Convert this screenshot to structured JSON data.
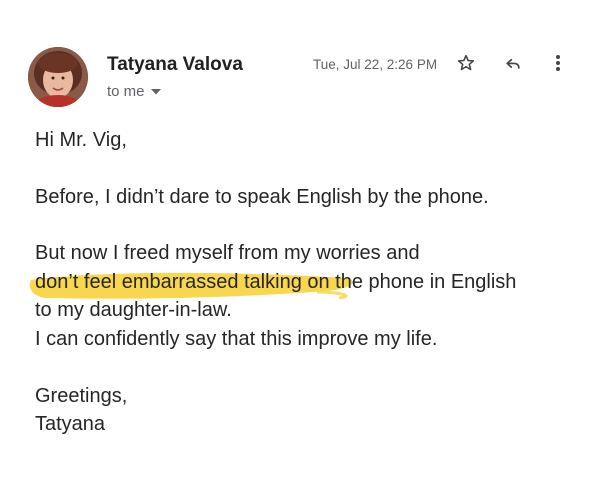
{
  "message": {
    "sender": "Tatyana Valova",
    "recipient_label": "to me",
    "timestamp": "Tue, Jul 22, 2:26 PM",
    "lines": [
      "Hi Mr. Vig,",
      "Before, I didn’t dare to speak English by the phone.",
      "But now I freed myself from my worries and",
      "don’t feel embarrassed talking on the phone in English",
      "to my daughter-in-law.",
      "I can confidently say that this improve my life.",
      "Greetings,",
      "Tatyana"
    ]
  },
  "icons": {
    "star": "star-icon",
    "reply": "reply-icon",
    "more": "more-vert-icon",
    "dropdown": "chevron-down-icon"
  },
  "colors": {
    "highlight": "#f7d23e"
  }
}
